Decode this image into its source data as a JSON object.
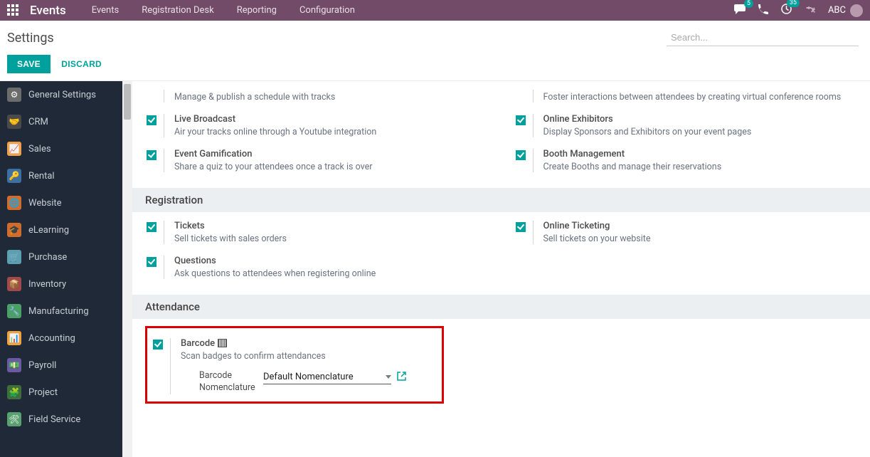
{
  "topbar": {
    "brand": "Events",
    "nav": [
      "Events",
      "Registration Desk",
      "Reporting",
      "Configuration"
    ],
    "chat_badge": "5",
    "activity_badge": "35",
    "user": "ABC"
  },
  "header": {
    "title": "Settings",
    "search_placeholder": "Search..."
  },
  "actions": {
    "save": "SAVE",
    "discard": "DISCARD"
  },
  "sidebar": [
    {
      "label": "General Settings",
      "color": "#6c6c6c"
    },
    {
      "label": "CRM",
      "color": "#4a4a4a"
    },
    {
      "label": "Sales",
      "color": "#f0a14a"
    },
    {
      "label": "Rental",
      "color": "#3d6fa3"
    },
    {
      "label": "Website",
      "color": "#d26c2c"
    },
    {
      "label": "eLearning",
      "color": "#d26c2c"
    },
    {
      "label": "Purchase",
      "color": "#5aa0b2"
    },
    {
      "label": "Inventory",
      "color": "#a14a4a"
    },
    {
      "label": "Manufacturing",
      "color": "#4aa168"
    },
    {
      "label": "Accounting",
      "color": "#f2a23a"
    },
    {
      "label": "Payroll",
      "color": "#6a5aa1"
    },
    {
      "label": "Project",
      "color": "#3d6f3d"
    },
    {
      "label": "Field Service",
      "color": "#5aa170"
    }
  ],
  "settings": {
    "top_left": [
      {
        "desc_only": "Manage & publish a schedule with tracks"
      },
      {
        "title": "Live Broadcast",
        "desc": "Air your tracks online through a Youtube integration"
      },
      {
        "title": "Event Gamification",
        "desc": "Share a quiz to your attendees once a track is over"
      }
    ],
    "top_right": [
      {
        "desc_only": "Foster interactions between attendees by creating virtual conference rooms"
      },
      {
        "title": "Online Exhibitors",
        "desc": "Display Sponsors and Exhibitors on your event pages"
      },
      {
        "title": "Booth Management",
        "desc": "Create Booths and manage their reservations"
      }
    ],
    "section_registration": "Registration",
    "reg_left": [
      {
        "title": "Tickets",
        "desc": "Sell tickets with sales orders"
      },
      {
        "title": "Questions",
        "desc": "Ask questions to attendees when registering online"
      }
    ],
    "reg_right": [
      {
        "title": "Online Ticketing",
        "desc": "Sell tickets on your website"
      }
    ],
    "section_attendance": "Attendance",
    "barcode": {
      "title": "Barcode",
      "desc": "Scan badges to confirm attendances",
      "field_label": "Barcode Nomenclature",
      "value": "Default Nomenclature"
    }
  }
}
